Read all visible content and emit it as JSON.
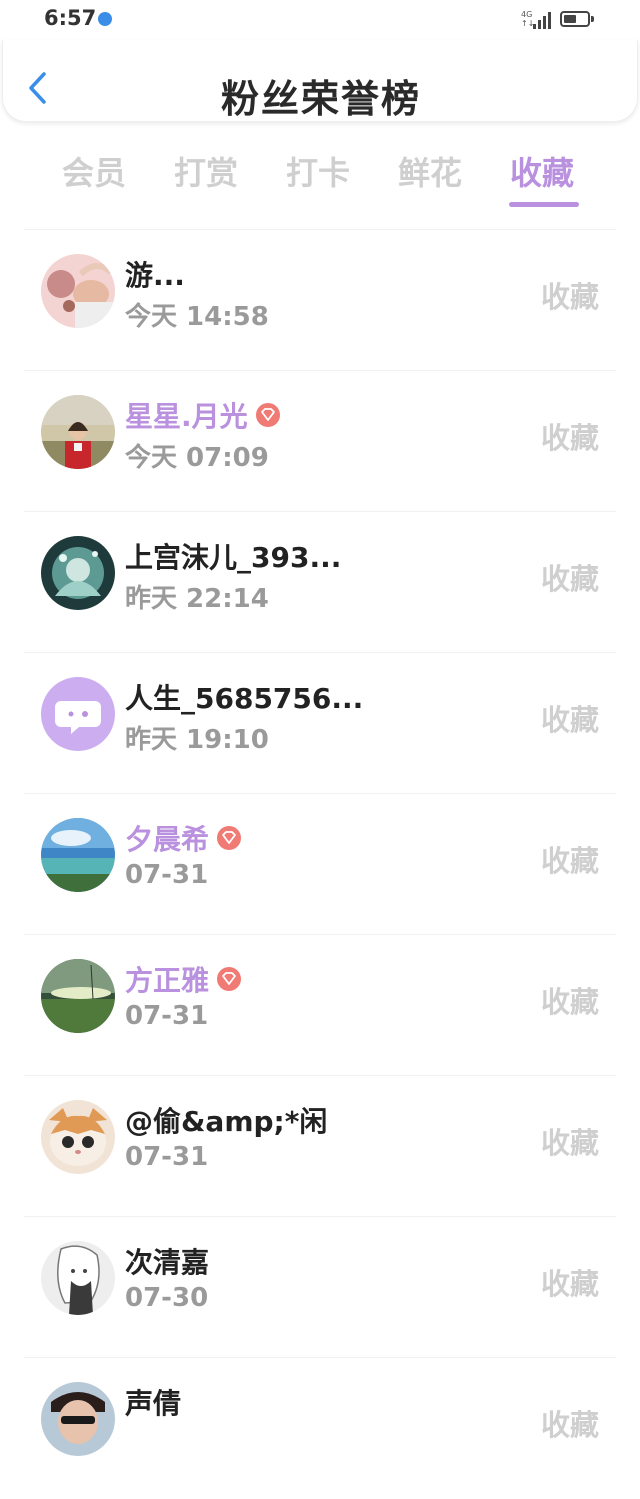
{
  "status_bar": {
    "time": "6:57",
    "network": "4G",
    "network_sub": "↑↓",
    "battery_level": 0.55
  },
  "header": {
    "title": "粉丝荣誉榜"
  },
  "tabs": [
    {
      "label": "会员",
      "active": false
    },
    {
      "label": "打赏",
      "active": false
    },
    {
      "label": "打卡",
      "active": false
    },
    {
      "label": "鲜花",
      "active": false
    },
    {
      "label": "收藏",
      "active": true
    }
  ],
  "accent_color": "#b991df",
  "vip_badge_color": "#f07a74",
  "fans": [
    {
      "name": "游...",
      "time": "今天 14:58",
      "action": "收藏",
      "vip": false,
      "avatar": "cartoon-cat-avatar"
    },
    {
      "name": "星星.月光",
      "time": "今天 07:09",
      "action": "收藏",
      "vip": true,
      "avatar": "girl-photo-avatar"
    },
    {
      "name": "上宫沫儿_393...",
      "time": "昨天 22:14",
      "action": "收藏",
      "vip": false,
      "avatar": "fantasy-art-avatar"
    },
    {
      "name": "人生_5685756...",
      "time": "昨天 19:10",
      "action": "收藏",
      "vip": false,
      "avatar": "default-chat-avatar"
    },
    {
      "name": "夕晨希",
      "time": "07-31",
      "action": "收藏",
      "vip": true,
      "avatar": "sea-landscape-avatar"
    },
    {
      "name": "方正雅",
      "time": "07-31",
      "action": "收藏",
      "vip": true,
      "avatar": "green-field-avatar"
    },
    {
      "name": "@偷&amp;*闲",
      "time": "07-31",
      "action": "收藏",
      "vip": false,
      "avatar": "kitten-photo-avatar"
    },
    {
      "name": "次清嘉",
      "time": "07-30",
      "action": "收藏",
      "vip": false,
      "avatar": "anime-sketch-avatar"
    },
    {
      "name": "声倩",
      "time": "",
      "action": "收藏",
      "vip": false,
      "avatar": "person-photo-avatar"
    }
  ]
}
